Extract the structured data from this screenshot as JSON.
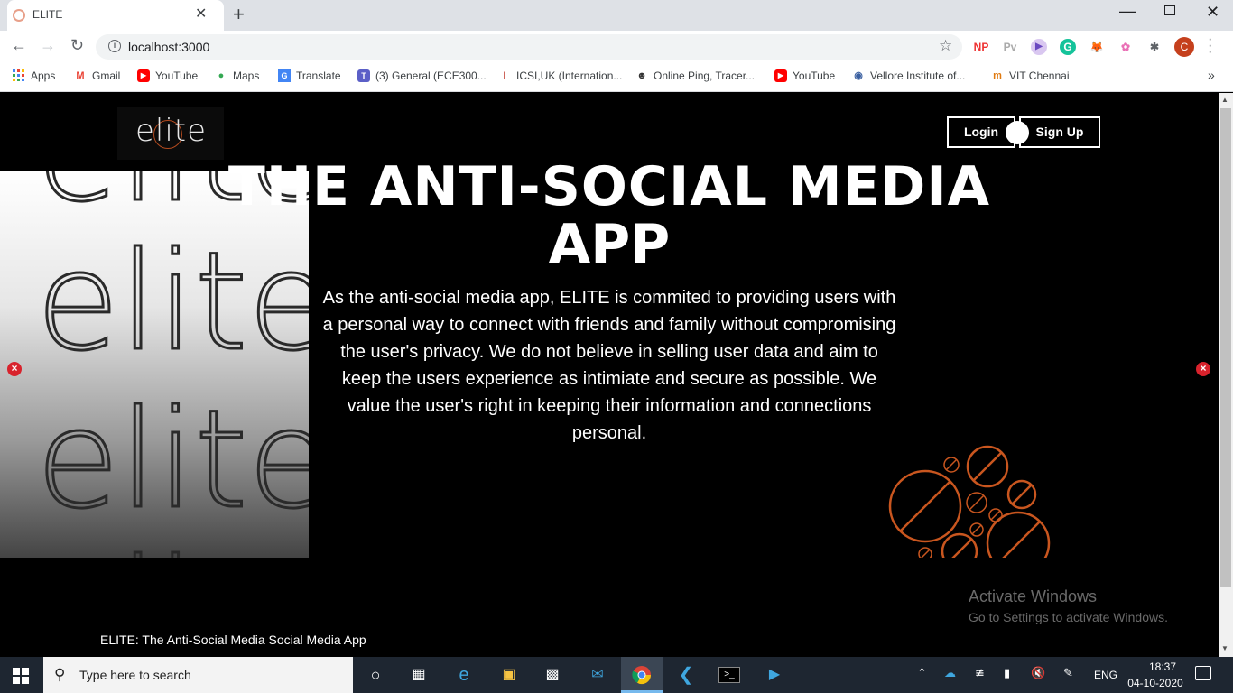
{
  "browser": {
    "tab_title": "ELITE",
    "tab_close": "✕",
    "new_tab": "+",
    "url": "localhost:3000",
    "profile_initial": "C",
    "extensions": [
      "NP",
      "Pv",
      "▶",
      "G",
      "🦊",
      "✿",
      "✱"
    ]
  },
  "bookmarks": [
    {
      "label": "Apps",
      "icon": "apps-grid-icon"
    },
    {
      "label": "Gmail",
      "icon": "gmail-icon"
    },
    {
      "label": "YouTube",
      "icon": "youtube-icon"
    },
    {
      "label": "Maps",
      "icon": "maps-icon"
    },
    {
      "label": "Translate",
      "icon": "translate-icon"
    },
    {
      "label": "(3) General (ECE300...",
      "icon": "teams-icon"
    },
    {
      "label": "ICSI,UK (Internation...",
      "icon": "icsi-icon"
    },
    {
      "label": "Online Ping, Tracer...",
      "icon": "ping-icon"
    },
    {
      "label": "YouTube",
      "icon": "youtube-icon"
    },
    {
      "label": "Vellore Institute of...",
      "icon": "vit-icon"
    },
    {
      "label": "VIT Chennai",
      "icon": "vit-chennai-icon"
    }
  ],
  "page": {
    "logo": "elite",
    "login_label": "Login",
    "signup_label": "Sign Up",
    "headline_line1": "THE ANTI-SOCIAL MEDIA",
    "headline_line2": "APP",
    "description": "As the anti-social media app, ELITE is commited to providing users with a personal way to connect with friends and family without compromising the user's privacy. We do not believe in selling user data and aim to keep the users experience as intimiate and secure as possible. We value the user's right in keeping their information and connections personal.",
    "side_words": [
      "elite",
      "elite",
      "elite",
      "elite"
    ],
    "footer": "ELITE: The Anti-Social Media Social Media App"
  },
  "watermark": {
    "title": "Activate Windows",
    "subtitle": "Go to Settings to activate Windows."
  },
  "taskbar": {
    "search_placeholder": "Type here to search",
    "language": "ENG",
    "time": "18:37",
    "date": "04-10-2020"
  },
  "colors": {
    "accent_orange": "#c9561f",
    "close_red": "#d8222c",
    "taskbar_bg": "#1e2631"
  }
}
